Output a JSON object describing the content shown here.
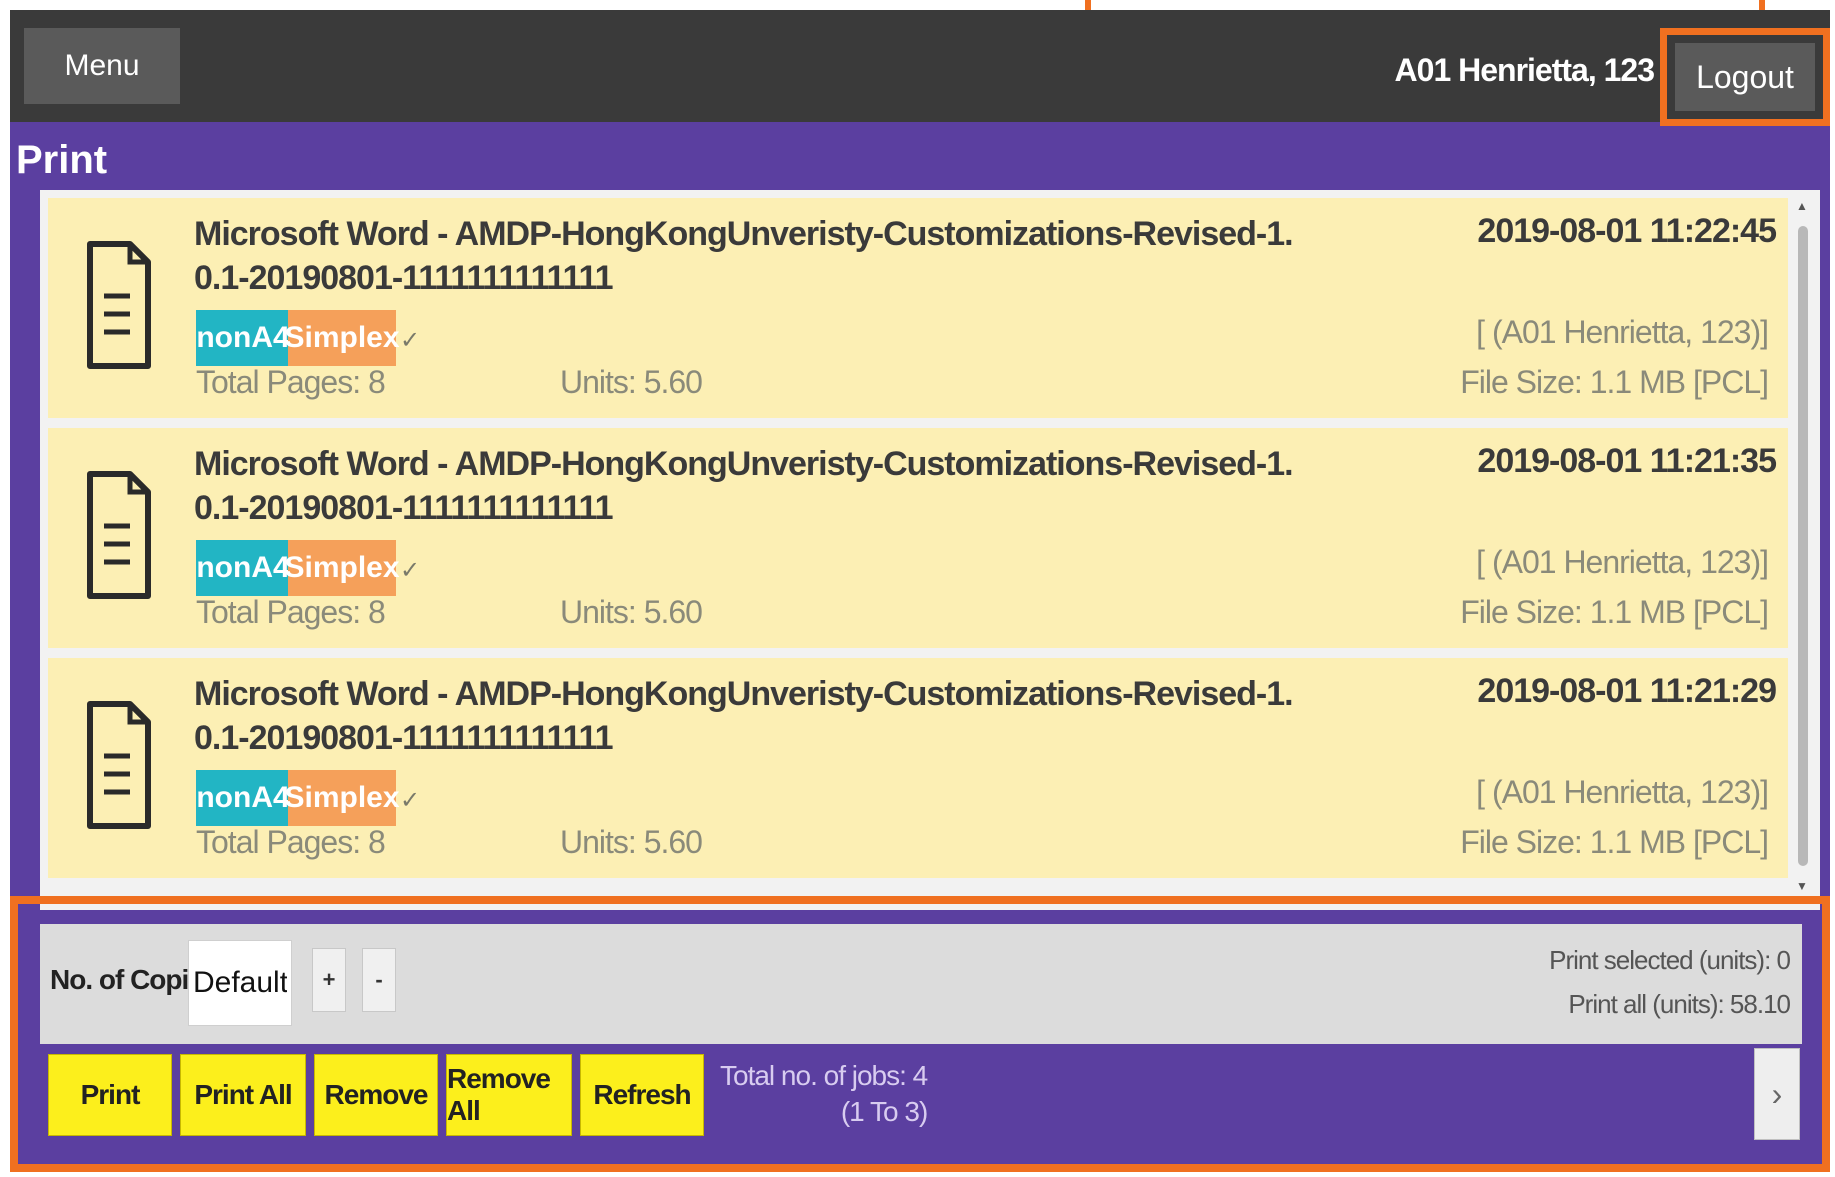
{
  "header": {
    "menu_label": "Menu",
    "user_name": "A01 Henrietta, 123",
    "logout_label": "Logout"
  },
  "page": {
    "title": "Print"
  },
  "jobs": [
    {
      "title": "Microsoft Word - AMDP-HongKongUnveristy-Customizations-Revised-1.0.1-20190801-1111111111111",
      "datetime": "2019-08-01 11:22:45",
      "paper_tag": "nonA4",
      "duplex_tag": "Simplex",
      "check": "✓",
      "owner": "[ (A01 Henrietta, 123)]",
      "total_pages": "Total Pages: 8",
      "units": "Units: 5.60",
      "file_size": "File Size: 1.1 MB [PCL]"
    },
    {
      "title": "Microsoft Word - AMDP-HongKongUnveristy-Customizations-Revised-1.0.1-20190801-1111111111111",
      "datetime": "2019-08-01 11:21:35",
      "paper_tag": "nonA4",
      "duplex_tag": "Simplex",
      "check": "✓",
      "owner": "[ (A01 Henrietta, 123)]",
      "total_pages": "Total Pages: 8",
      "units": "Units: 5.60",
      "file_size": "File Size: 1.1 MB [PCL]"
    },
    {
      "title": "Microsoft Word - AMDP-HongKongUnveristy-Customizations-Revised-1.0.1-20190801-1111111111111",
      "datetime": "2019-08-01 11:21:29",
      "paper_tag": "nonA4",
      "duplex_tag": "Simplex",
      "check": "✓",
      "owner": "[ (A01 Henrietta, 123)]",
      "total_pages": "Total Pages: 8",
      "units": "Units: 5.60",
      "file_size": "File Size: 1.1 MB [PCL]"
    }
  ],
  "copies": {
    "label": "No. of Copies:",
    "value": "Default",
    "plus_label": "+",
    "minus_label": "-"
  },
  "units_summary": {
    "selected": "Print selected (units): 0",
    "all": "Print all (units): 58.10"
  },
  "actions": {
    "print": "Print",
    "print_all": "Print All",
    "remove": "Remove",
    "remove_all": "Remove All",
    "refresh": "Refresh"
  },
  "pagination": {
    "total_jobs": "Total no. of jobs: 4",
    "range": "(1 To 3)",
    "next_label": "›"
  },
  "colors": {
    "brand_purple": "#5b3fa0",
    "header_dark": "#3a3a3a",
    "job_bg": "#fcefb4",
    "paper_tag": "#22b5c4",
    "duplex_tag": "#f5a05a",
    "action_yellow": "#fcef1c",
    "highlight_orange": "#f07020"
  },
  "icons": {
    "job": "document-icon",
    "next": "chevron-right-icon"
  }
}
